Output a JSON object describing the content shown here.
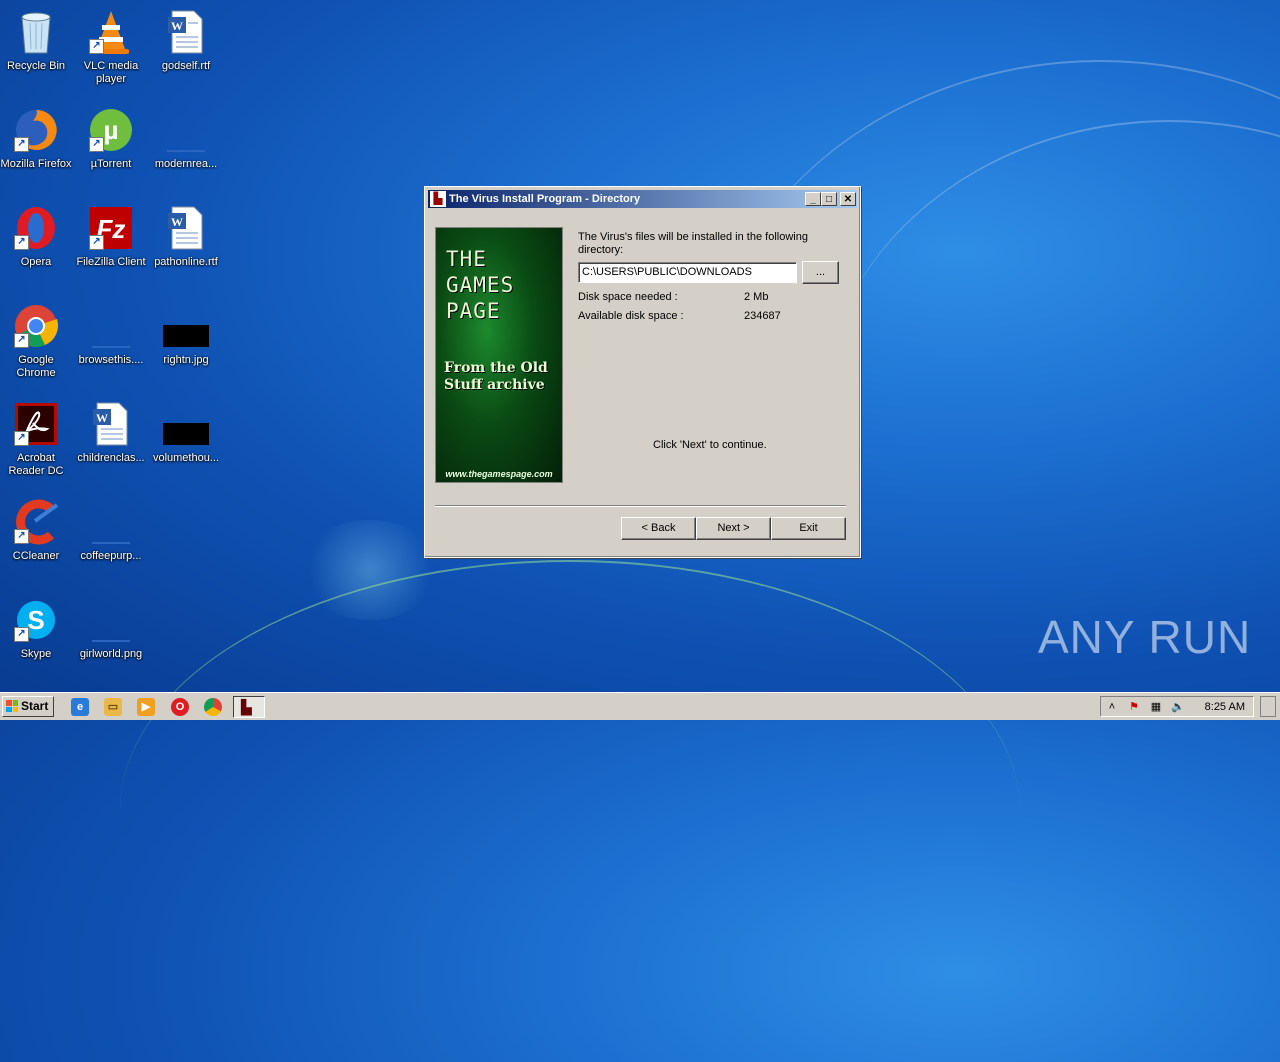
{
  "desktop": {
    "icons": [
      {
        "label": "Recycle Bin"
      },
      {
        "label": "VLC media player"
      },
      {
        "label": "godself.rtf"
      },
      {
        "label": "Mozilla Firefox"
      },
      {
        "label": "µTorrent"
      },
      {
        "label": "modernrea..."
      },
      {
        "label": "Opera"
      },
      {
        "label": "FileZilla Client"
      },
      {
        "label": "pathonline.rtf"
      },
      {
        "label": "Google Chrome"
      },
      {
        "label": "browsethis...."
      },
      {
        "label": "rightn.jpg"
      },
      {
        "label": "Acrobat Reader DC"
      },
      {
        "label": "childrenclas..."
      },
      {
        "label": "volumethou..."
      },
      {
        "label": "CCleaner"
      },
      {
        "label": "coffeepurp..."
      },
      {
        "label": "Skype"
      },
      {
        "label": "girlworld.png"
      }
    ],
    "watermark": "ANY RUN"
  },
  "dialog": {
    "title": "The Virus Install Program - Directory",
    "banner": {
      "logo": "THE GAMES PAGE",
      "tagline": "From the Old Stuff archive",
      "url": "www.thegamespage.com"
    },
    "intro": "The Virus's files will be installed in the following directory:",
    "path_value": "C:\\USERS\\PUBLIC\\DOWNLOADS",
    "browse_label": "...",
    "disk_needed_label": "Disk space needed :",
    "disk_needed_value": "2 Mb",
    "disk_available_label": "Available disk space :",
    "disk_available_value": "234687",
    "continue_text": "Click 'Next' to continue.",
    "buttons": {
      "back": "< Back",
      "next": "Next >",
      "exit": "Exit"
    }
  },
  "taskbar": {
    "start_label": "Start",
    "clock": "8:25 AM"
  }
}
